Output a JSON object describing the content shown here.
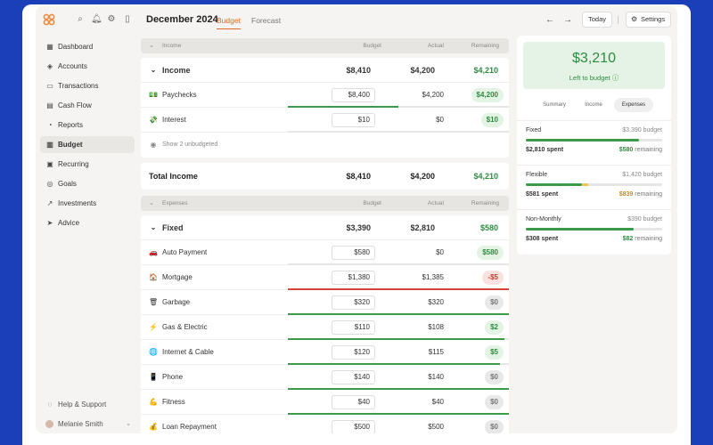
{
  "header": {
    "month": "December 2024",
    "tabs": [
      {
        "label": "Budget",
        "active": true
      },
      {
        "label": "Forecast",
        "active": false
      }
    ],
    "today_label": "Today",
    "settings_label": "Settings"
  },
  "sidebar": {
    "items": [
      {
        "label": "Dashboard",
        "icon": "grid-icon"
      },
      {
        "label": "Accounts",
        "icon": "layers-icon"
      },
      {
        "label": "Transactions",
        "icon": "card-icon"
      },
      {
        "label": "Cash Flow",
        "icon": "cash-icon"
      },
      {
        "label": "Reports",
        "icon": "chart-icon"
      },
      {
        "label": "Budget",
        "icon": "map-icon",
        "active": true
      },
      {
        "label": "Recurring",
        "icon": "calendar-icon"
      },
      {
        "label": "Goals",
        "icon": "target-icon"
      },
      {
        "label": "Investments",
        "icon": "trend-icon"
      },
      {
        "label": "Advice",
        "icon": "send-icon"
      }
    ],
    "help_label": "Help & Support",
    "user_name": "Melanie Smith"
  },
  "income_section": {
    "header": {
      "name": "Income",
      "budget": "Budget",
      "actual": "Actual",
      "remaining": "Remaining"
    },
    "group": {
      "name": "Income",
      "budget": "$8,410",
      "actual": "$4,200",
      "remaining": "$4,210"
    },
    "rows": [
      {
        "icon": "💵",
        "name": "Paychecks",
        "budget": "$8,400",
        "actual": "$4,200",
        "remaining": "$4,200",
        "pill": "green",
        "progress": 0.5,
        "bar_color": "#3a9a4a"
      },
      {
        "icon": "💸",
        "name": "Interest",
        "budget": "$10",
        "actual": "$0",
        "remaining": "$10",
        "pill": "green",
        "progress": 0,
        "bar_color": "#3a9a4a"
      }
    ],
    "show_unbudgeted": "Show 2 unbudgeted",
    "total": {
      "name": "Total Income",
      "budget": "$8,410",
      "actual": "$4,200",
      "remaining": "$4,210"
    }
  },
  "expenses_section": {
    "header": {
      "name": "Expenses",
      "budget": "Budget",
      "actual": "Actual",
      "remaining": "Remaining"
    },
    "group": {
      "name": "Fixed",
      "budget": "$3,390",
      "actual": "$2,810",
      "remaining": "$580"
    },
    "rows": [
      {
        "icon": "🚗",
        "name": "Auto Payment",
        "budget": "$580",
        "actual": "$0",
        "remaining": "$580",
        "pill": "green",
        "progress": 0,
        "bar_color": "#3a9a4a"
      },
      {
        "icon": "🏠",
        "name": "Mortgage",
        "budget": "$1,380",
        "actual": "$1,385",
        "remaining": "-$5",
        "pill": "red",
        "progress": 1,
        "bar_color": "#d0463a"
      },
      {
        "icon": "🗑",
        "name": "Garbage",
        "budget": "$320",
        "actual": "$320",
        "remaining": "$0",
        "pill": "gray",
        "progress": 1,
        "bar_color": "#3a9a4a"
      },
      {
        "icon": "⚡",
        "name": "Gas & Electric",
        "budget": "$110",
        "actual": "$108",
        "remaining": "$2",
        "pill": "green",
        "progress": 0.98,
        "bar_color": "#3a9a4a"
      },
      {
        "icon": "🌐",
        "name": "Internet & Cable",
        "budget": "$120",
        "actual": "$115",
        "remaining": "$5",
        "pill": "green",
        "progress": 0.96,
        "bar_color": "#3a9a4a"
      },
      {
        "icon": "📱",
        "name": "Phone",
        "budget": "$140",
        "actual": "$140",
        "remaining": "$0",
        "pill": "gray",
        "progress": 1,
        "bar_color": "#3a9a4a"
      },
      {
        "icon": "💪",
        "name": "Fitness",
        "budget": "$40",
        "actual": "$40",
        "remaining": "$0",
        "pill": "gray",
        "progress": 1,
        "bar_color": "#3a9a4a"
      },
      {
        "icon": "💰",
        "name": "Loan Repayment",
        "budget": "$500",
        "actual": "$500",
        "remaining": "$0",
        "pill": "gray",
        "progress": 1,
        "bar_color": "#3a9a4a"
      }
    ]
  },
  "summary": {
    "amount": "$3,210",
    "subtitle": "Left to budget",
    "segments": [
      {
        "label": "Summary"
      },
      {
        "label": "Income"
      },
      {
        "label": "Expenses",
        "active": true
      }
    ],
    "budgets": [
      {
        "title": "Fixed",
        "budget": "$3,390 budget",
        "spent": "$2,810 spent",
        "remaining_amount": "$580",
        "remaining_label": "remaining",
        "remaining_color": "#2e8b3f",
        "progress": 0.83,
        "bar_color": "#3a9a4a"
      },
      {
        "title": "Flexible",
        "budget": "$1,420 budget",
        "spent": "$581 spent",
        "remaining_amount": "$839",
        "remaining_label": "remaining",
        "remaining_color": "#d4881e",
        "progress": 0.41,
        "bar_color": "#3a9a4a",
        "overage_color": "#f2c34a"
      },
      {
        "title": "Non-Monthly",
        "budget": "$390 budget",
        "spent": "$308 spent",
        "remaining_amount": "$82",
        "remaining_label": "remaining",
        "remaining_color": "#2e8b3f",
        "progress": 0.79,
        "bar_color": "#3a9a4a"
      }
    ]
  }
}
